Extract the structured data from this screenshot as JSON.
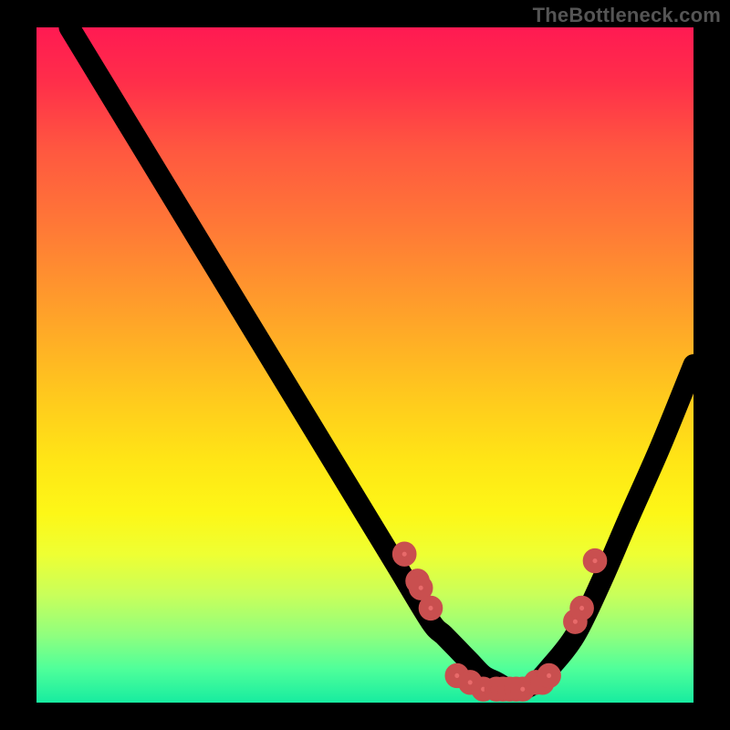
{
  "watermark": "TheBottleneck.com",
  "chart_data": {
    "type": "line",
    "title": "",
    "xlabel": "",
    "ylabel": "",
    "xlim": [
      0,
      100
    ],
    "ylim": [
      0,
      100
    ],
    "grid": false,
    "legend": false,
    "series": [
      {
        "name": "bottleneck-curve",
        "style": "line",
        "color": "#000000",
        "x": [
          5,
          10,
          15,
          20,
          25,
          30,
          35,
          40,
          45,
          50,
          55,
          60,
          62,
          64,
          66,
          68,
          70,
          72,
          74,
          76,
          78,
          82,
          86,
          90,
          95,
          100
        ],
        "y": [
          100,
          92,
          84,
          76,
          68,
          60,
          52,
          44,
          36,
          28,
          20,
          12,
          10,
          8,
          6,
          4,
          3,
          2,
          2,
          3,
          5,
          10,
          18,
          27,
          38,
          50
        ]
      },
      {
        "name": "markers",
        "style": "scatter",
        "color": "#e86a6a",
        "x": [
          56,
          58,
          58.5,
          60,
          64,
          66,
          68,
          70,
          71,
          72,
          73,
          74,
          76,
          77,
          78,
          82,
          83,
          85
        ],
        "y": [
          22,
          18,
          17,
          14,
          4,
          3,
          2,
          2,
          2,
          2,
          2,
          2,
          3,
          3,
          4,
          12,
          14,
          21
        ]
      }
    ],
    "background": {
      "type": "vertical-gradient",
      "stops": [
        {
          "pct": 0,
          "color": "#ff1a52"
        },
        {
          "pct": 30,
          "color": "#ff7a36"
        },
        {
          "pct": 60,
          "color": "#ffe516"
        },
        {
          "pct": 85,
          "color": "#c9ff5a"
        },
        {
          "pct": 100,
          "color": "#17eca0"
        }
      ]
    }
  }
}
